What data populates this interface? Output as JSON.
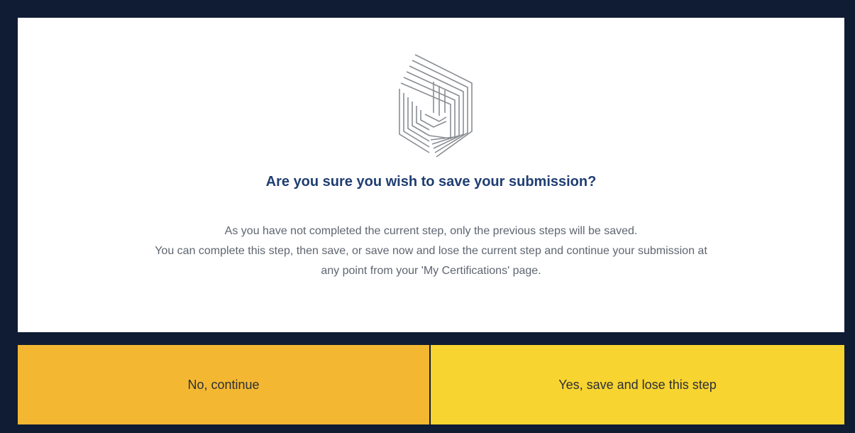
{
  "dialog": {
    "title": "Are you sure you wish to save your submission?",
    "body_lines": [
      "As you have not completed the current step, only the previous steps will be saved.",
      "You can complete this step, then save, or save now and lose the current step and continue your submission at",
      "any point from your 'My Certifications' page."
    ],
    "logo_icon": "nested-cube-lines-icon"
  },
  "buttons": {
    "no_label": "No, continue",
    "yes_label": "Yes, save and lose this step"
  },
  "colors": {
    "background": "#0f1c33",
    "title": "#1f3e72",
    "body_text": "#5f6570",
    "no_button": "#f4b731",
    "yes_button": "#f7d430"
  }
}
